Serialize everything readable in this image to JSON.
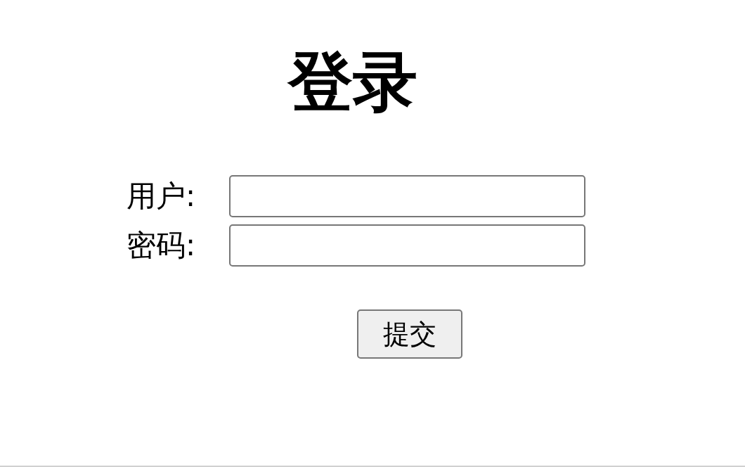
{
  "title": "登录",
  "fields": [
    {
      "label": "用户:"
    },
    {
      "label": "密码:"
    }
  ],
  "submit": "提交"
}
